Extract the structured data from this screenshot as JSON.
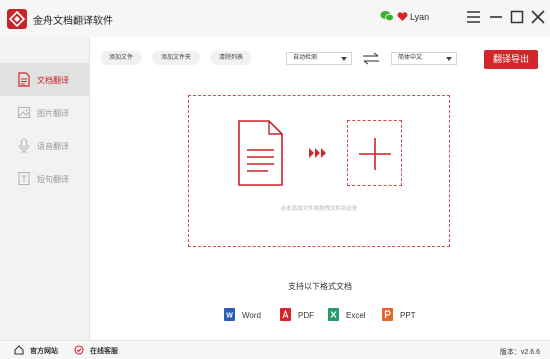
{
  "app": {
    "title": "金舟文档翻译软件",
    "user_name": "Lyan",
    "brand_color": "#d2262c"
  },
  "window_controls": {
    "menu_icon": "hamburger-icon",
    "minimize_icon": "minimize-icon",
    "maximize_icon": "maximize-icon",
    "close_icon": "close-icon"
  },
  "sidebar": {
    "items": [
      {
        "label": "文档翻译",
        "icon": "document-icon",
        "active": true
      },
      {
        "label": "图片翻译",
        "icon": "image-icon",
        "active": false
      },
      {
        "label": "语音翻译",
        "icon": "microphone-icon",
        "active": false
      },
      {
        "label": "短句翻译",
        "icon": "text-icon",
        "active": false
      }
    ]
  },
  "toolbar": {
    "add_file": "添加文件",
    "add_folder": "添加文件夹",
    "clear_list": "清除列表",
    "source_lang": "自动检测",
    "target_lang": "简体中文",
    "export": "翻译导出"
  },
  "dropzone": {
    "hint": "点击添加文件或拖拽文件到此处"
  },
  "formats": {
    "title": "支持以下格式文档",
    "items": [
      {
        "label": "Word",
        "icon": "word-icon",
        "color": "#2b5fb4"
      },
      {
        "label": "PDF",
        "icon": "pdf-icon",
        "color": "#d2262c"
      },
      {
        "label": "Excel",
        "icon": "excel-icon",
        "color": "#1f9e6a"
      },
      {
        "label": "PPT",
        "icon": "ppt-icon",
        "color": "#e0662b"
      }
    ]
  },
  "statusbar": {
    "official_site": "官方网站",
    "online_support": "在线客服",
    "version": "版本：v2.6.6"
  }
}
